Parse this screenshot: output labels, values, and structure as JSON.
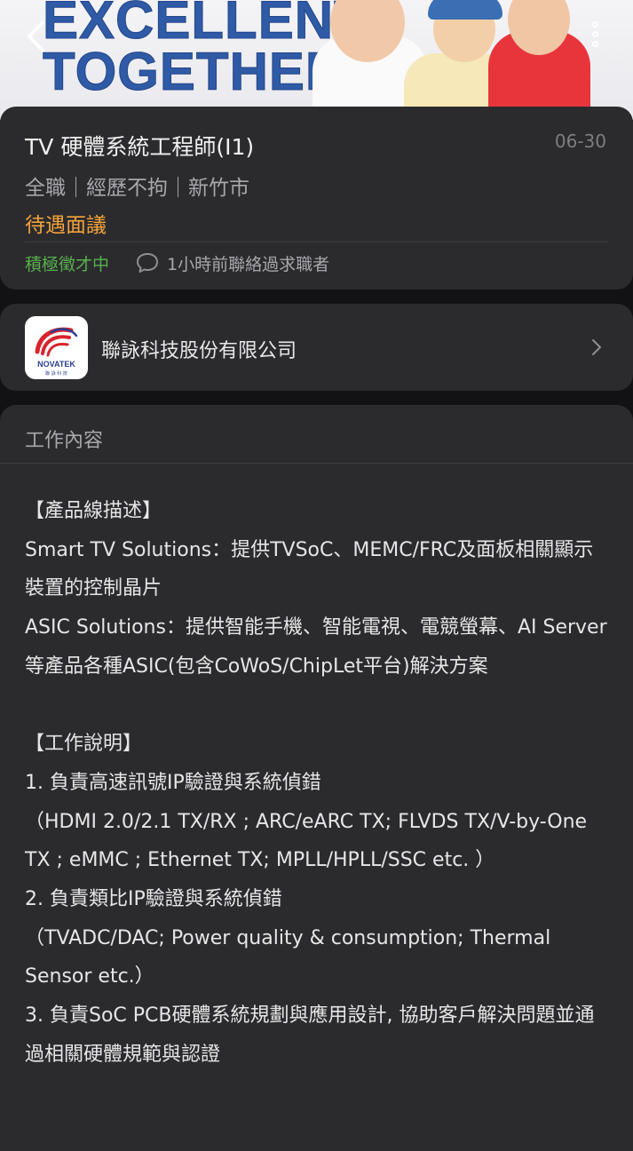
{
  "banner": {
    "line1": "EXCELLENT",
    "line2": "TOGETHER"
  },
  "icons": {
    "back": "chevron-left-icon",
    "more": "more-vertical-icon",
    "chat": "chat-bubble-icon",
    "chevron": "chevron-right-icon"
  },
  "job": {
    "title": "TV 硬體系統工程師(I1)",
    "date": "06-30",
    "meta": "全職｜經歷不拘｜新竹市",
    "salary": "待遇面議",
    "status": "積極徵才中",
    "contact": "1小時前聯絡過求職者"
  },
  "company": {
    "name": "聯詠科技股份有限公司",
    "logo_text": "NOVATEK",
    "logo_sub": "聯 詠 科 技"
  },
  "content": {
    "heading": "工作內容",
    "lines": [
      "【產品線描述】",
      "Smart TV Solutions：提供TVSoC、MEMC/FRC及面板相關顯示裝置的控制晶片",
      "ASIC Solutions：提供智能手機、智能電視、電競螢幕、AI Server等產品各種ASIC(包含CoWoS/ChipLet平台)解決方案",
      "",
      "【工作說明】",
      "1. 負責高速訊號IP驗證與系統偵錯",
      "（HDMI 2.0/2.1 TX/RX ; ARC/eARC TX; FLVDS TX/V-by-One TX ; eMMC ; Ethernet TX; MPLL/HPLL/SSC etc. ）",
      "2. 負責類比IP驗證與系統偵錯",
      "（TVADC/DAC; Power quality & consumption; Thermal Sensor etc.）",
      "3. 負責SoC PCB硬體系統規劃與應用設計, 協助客戶解決問題並通過相關硬體規範與認證"
    ]
  },
  "colors": {
    "background": "#121214",
    "card": "#2b2b2e",
    "salary": "#f3a33a",
    "status": "#58b04c",
    "banner_text": "#2f5aa6"
  }
}
